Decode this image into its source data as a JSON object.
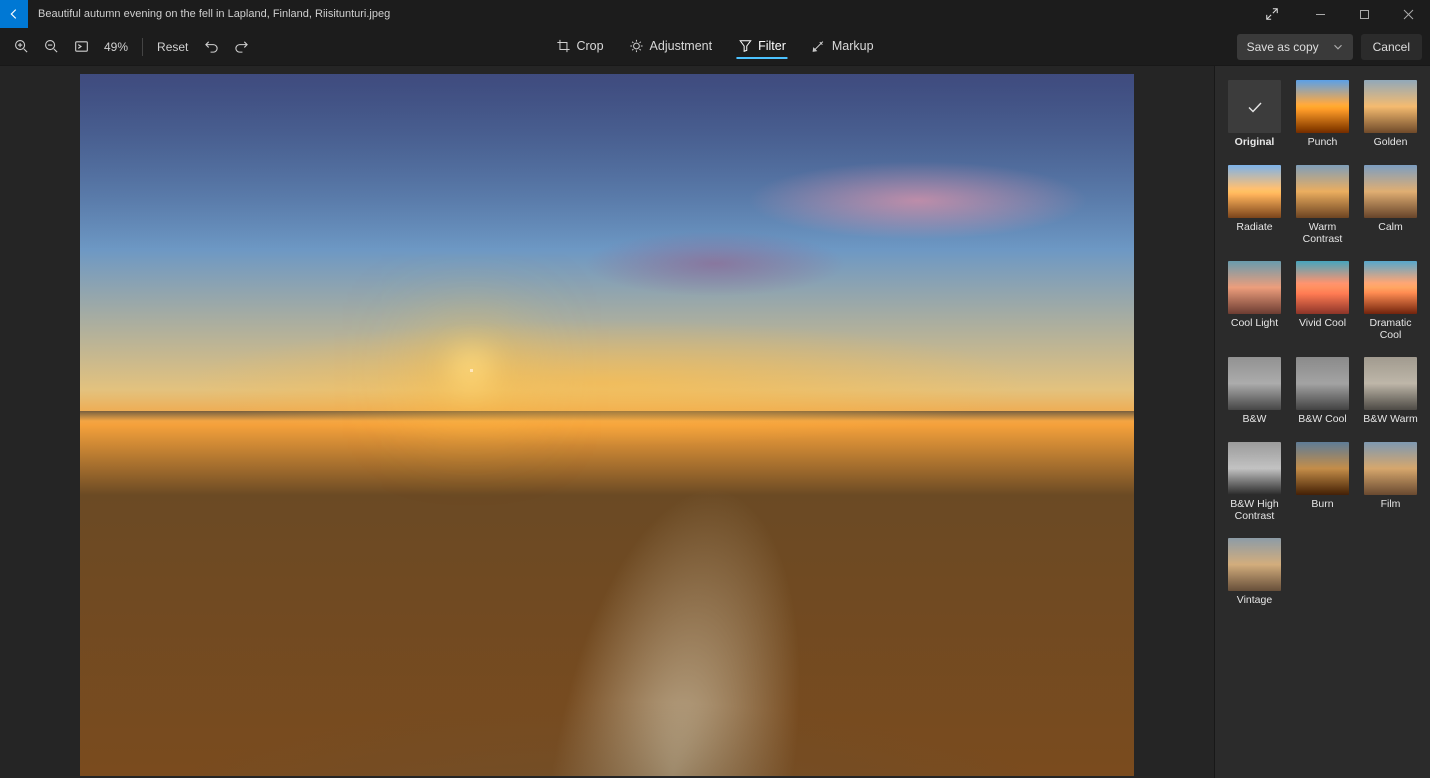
{
  "title": "Beautiful autumn evening on the fell in Lapland, Finland, Riisitunturi.jpeg",
  "toolbar": {
    "zoom_level": "49%",
    "reset_label": "Reset",
    "modes": {
      "crop": "Crop",
      "adjustment": "Adjustment",
      "filter": "Filter",
      "markup": "Markup"
    },
    "save_label": "Save as copy",
    "cancel_label": "Cancel"
  },
  "filters": {
    "selected": "Original",
    "items": [
      {
        "label": "Original",
        "cls": "sel",
        "selected": true
      },
      {
        "label": "Punch",
        "cls": "punch"
      },
      {
        "label": "Golden",
        "cls": "golden"
      },
      {
        "label": "Radiate",
        "cls": "radiate"
      },
      {
        "label": "Warm Contrast",
        "cls": "warm"
      },
      {
        "label": "Calm",
        "cls": "calm"
      },
      {
        "label": "Cool Light",
        "cls": "cool"
      },
      {
        "label": "Vivid Cool",
        "cls": "vcool"
      },
      {
        "label": "Dramatic Cool",
        "cls": "drcool"
      },
      {
        "label": "B&W",
        "cls": "bw"
      },
      {
        "label": "B&W Cool",
        "cls": "bwcool"
      },
      {
        "label": "B&W Warm",
        "cls": "bwwarm"
      },
      {
        "label": "B&W High Contrast",
        "cls": "bwhc"
      },
      {
        "label": "Burn",
        "cls": "burn"
      },
      {
        "label": "Film",
        "cls": "film"
      },
      {
        "label": "Vintage",
        "cls": "vint"
      }
    ]
  }
}
